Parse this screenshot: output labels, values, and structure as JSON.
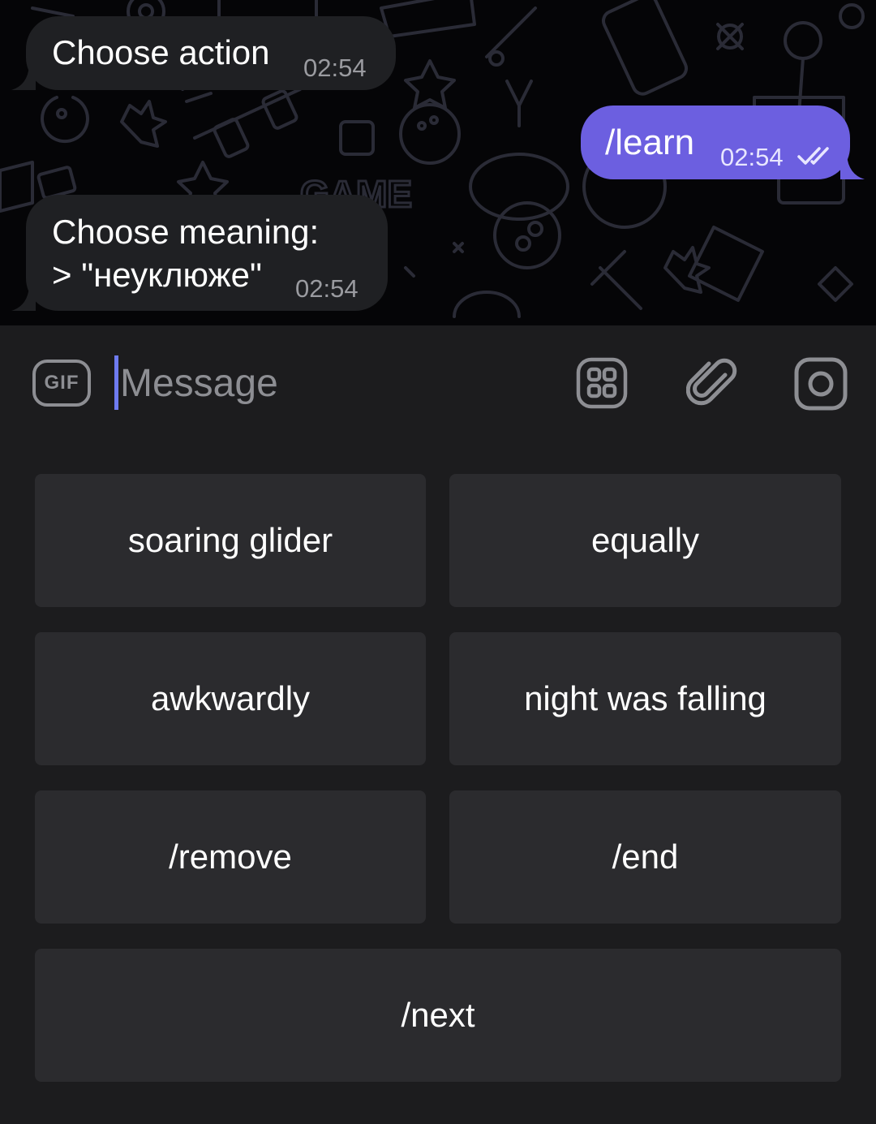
{
  "messages": [
    {
      "direction": "incoming",
      "text": "Choose action",
      "time": "02:54"
    },
    {
      "direction": "outgoing",
      "text": "/learn",
      "time": "02:54",
      "status": "read"
    },
    {
      "direction": "incoming",
      "line1": "Choose meaning:",
      "line2": "> \"неуклюже\"",
      "time": "02:54"
    }
  ],
  "background_text": "GAME",
  "composer": {
    "gif_label": "GIF",
    "placeholder": "Message",
    "icons": [
      "gif-icon",
      "stickers-icon",
      "attach-paperclip-icon",
      "camera-icon"
    ]
  },
  "keyboard": {
    "buttons": [
      "soaring glider",
      "equally",
      "awkwardly",
      "night was falling",
      "/remove",
      "/end",
      "/next"
    ]
  },
  "colors": {
    "chat_background": "#050507",
    "incoming_bubble": "#1f2023",
    "outgoing_bubble": "#6c5fe0",
    "panel": "#1c1c1e",
    "key": "#2b2b2e",
    "caret": "#6e7bf0"
  }
}
